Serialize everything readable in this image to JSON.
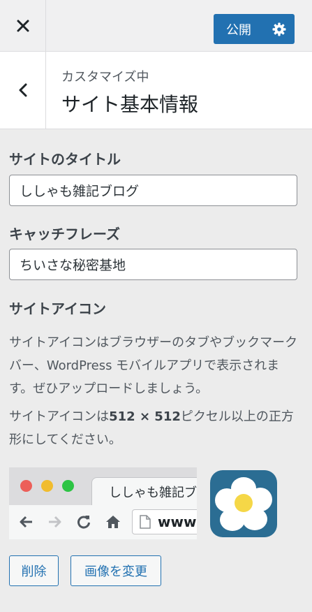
{
  "header": {
    "close_icon": "close-icon",
    "publish_label": "公開",
    "settings_icon": "gear-icon",
    "accent_color": "#2271b1"
  },
  "section": {
    "back_icon": "chevron-left-icon",
    "subtitle": "カスタマイズ中",
    "title": "サイト基本情報"
  },
  "site_title": {
    "label": "サイトのタイトル",
    "value": "ししゃも雑記ブログ"
  },
  "tagline": {
    "label": "キャッチフレーズ",
    "value": "ちいさな秘密基地"
  },
  "site_icon": {
    "label": "サイトアイコン",
    "description": "サイトアイコンはブラウザーのタブやブックマークバー、WordPress モバイルアプリで表示されます。ぜひアップロードしましょう。",
    "size_note_prefix": "サイトアイコンは",
    "size_note_bold": "512 × 512",
    "size_note_suffix": "ピクセル以上の正方形にしてください。",
    "preview": {
      "tab_title": "ししゃも雑記ブログ",
      "url_text": "www."
    },
    "icon_bg_color": "#2b6d93"
  },
  "actions": {
    "remove_label": "削除",
    "change_label": "画像を変更"
  }
}
